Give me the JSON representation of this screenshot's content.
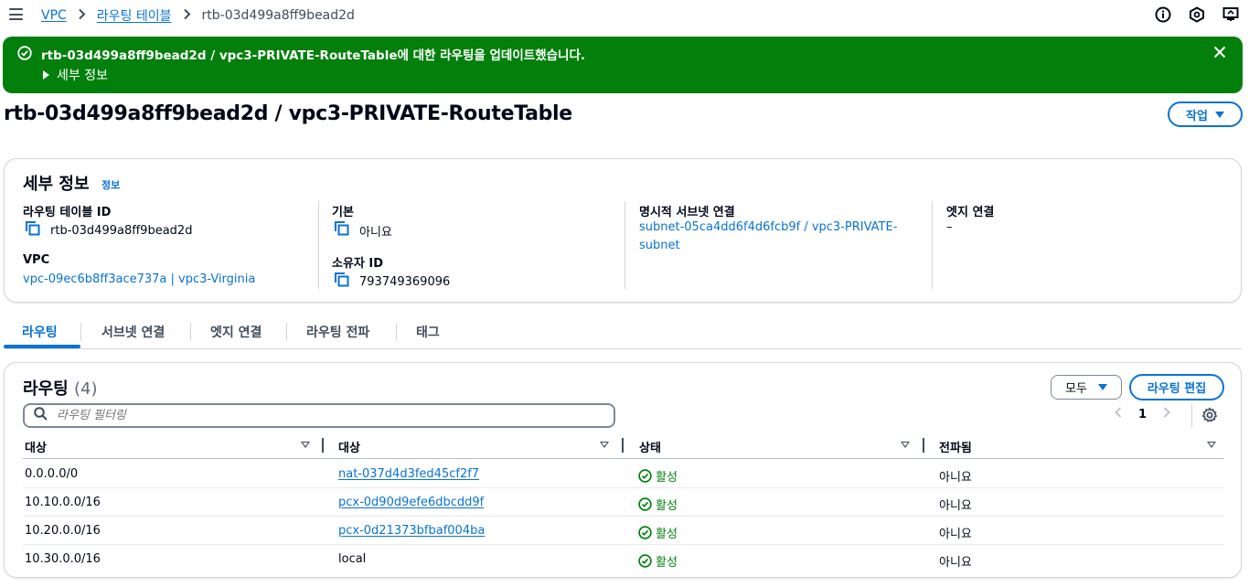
{
  "breadcrumb": {
    "items": [
      "VPC",
      "라우팅 테이블",
      "rtb-03d499a8ff9bead2d"
    ]
  },
  "flash": {
    "message": "rtb-03d499a8ff9bead2d / vpc3-PRIVATE-RouteTable에 대한 라우팅을 업데이트했습니다.",
    "details_label": "세부 정보",
    "color": "#037f0c"
  },
  "page": {
    "title": "rtb-03d499a8ff9bead2d / vpc3-PRIVATE-RouteTable",
    "actions_label": "작업"
  },
  "details": {
    "heading": "세부 정보",
    "info_link": "정보",
    "route_table_id_label": "라우팅 테이블 ID",
    "route_table_id": "rtb-03d499a8ff9bead2d",
    "main_label": "기본",
    "main_value": "아니요",
    "explicit_subnet_label": "명시적 서브넷 연결",
    "explicit_subnet_value_1": "subnet-05ca4dd6f4d6fcb9f / vpc3-PRIVATE-",
    "explicit_subnet_value_2": "subnet",
    "edge_label": "엣지 연결",
    "edge_value": "–",
    "vpc_label": "VPC",
    "vpc_value": "vpc-09ec6b8ff3ace737a | vpc3-Virginia",
    "owner_label": "소유자 ID",
    "owner_value": "793749369096"
  },
  "tabs": [
    "라우팅",
    "서브넷 연결",
    "엣지 연결",
    "라우팅 전파",
    "태그"
  ],
  "routes": {
    "heading": "라우팅",
    "count": "(4)",
    "select_label": "모두",
    "edit_label": "라우팅 편집",
    "filter_placeholder": "라우팅 필터링",
    "page": "1",
    "columns": [
      "대상",
      "대상",
      "상태",
      "전파됨"
    ],
    "rows": [
      {
        "destination": "0.0.0.0/0",
        "target": "nat-037d4d3fed45cf2f7",
        "target_link": true,
        "status": "활성",
        "propagated": "아니요"
      },
      {
        "destination": "10.10.0.0/16",
        "target": "pcx-0d90d9efe6dbcdd9f",
        "target_link": true,
        "status": "활성",
        "propagated": "아니요"
      },
      {
        "destination": "10.20.0.0/16",
        "target": "pcx-0d21373bfbaf004ba",
        "target_link": true,
        "status": "활성",
        "propagated": "아니요"
      },
      {
        "destination": "10.30.0.0/16",
        "target": "local",
        "target_link": false,
        "status": "활성",
        "propagated": "아니요"
      }
    ]
  }
}
